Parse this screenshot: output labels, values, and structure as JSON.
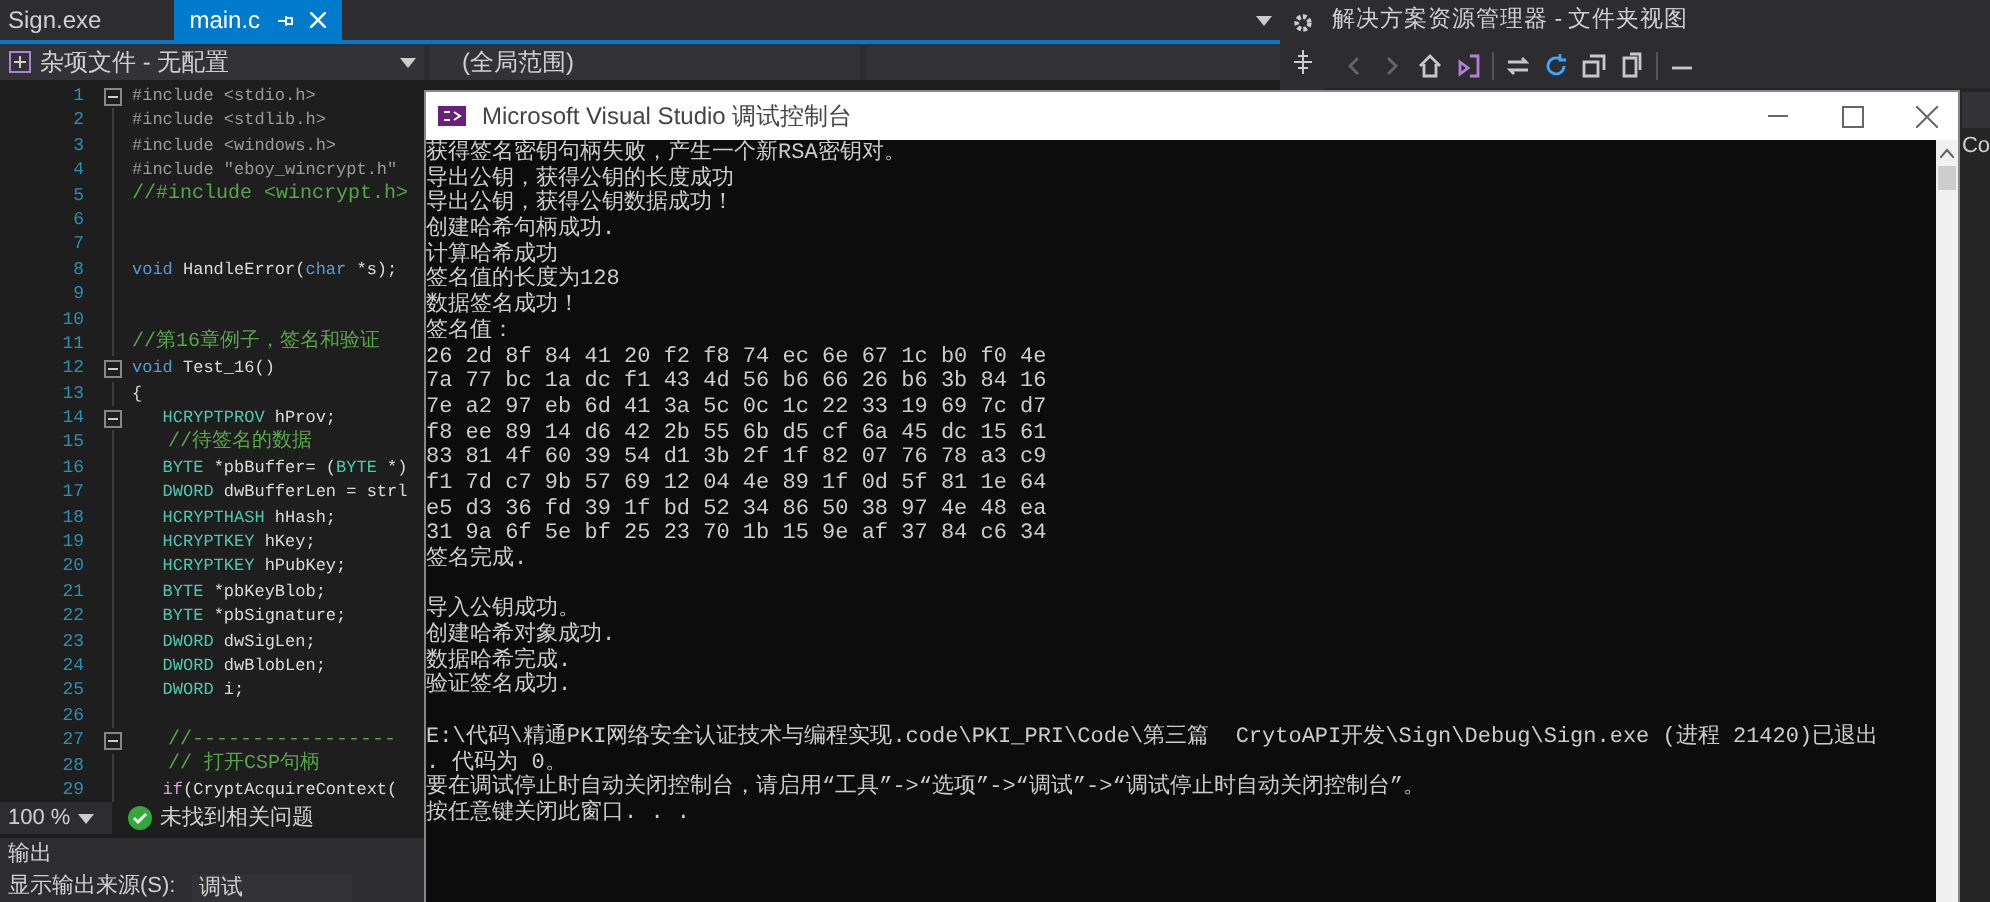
{
  "tabs": [
    {
      "label": "Sign.exe",
      "selected": false
    },
    {
      "label": "main.c",
      "selected": true
    }
  ],
  "nav": {
    "project": "杂项文件 - 无配置",
    "scope": "(全局范围)"
  },
  "code_lines": [
    {
      "number": "1",
      "fold": true,
      "tokens": [
        {
          "text": "#include <stdio.h>",
          "kind": "pp"
        }
      ]
    },
    {
      "number": "2",
      "fold": false,
      "tokens": [
        {
          "text": "#include <stdlib.h>",
          "kind": "pp"
        }
      ]
    },
    {
      "number": "3",
      "fold": false,
      "tokens": [
        {
          "text": "#include <windows.h>",
          "kind": "pp"
        }
      ]
    },
    {
      "number": "4",
      "fold": false,
      "tokens": [
        {
          "text": "#include \"eboy_wincrypt.h\"",
          "kind": "pp"
        }
      ]
    },
    {
      "number": "5",
      "fold": false,
      "tokens": [
        {
          "text": "//#include <wincrypt.h>",
          "kind": "comment"
        }
      ]
    },
    {
      "number": "6",
      "fold": false
    },
    {
      "number": "7",
      "fold": false
    },
    {
      "number": "8",
      "fold": false,
      "tokens": [
        {
          "text": "void",
          "kind": "kw"
        },
        {
          "text": " HandleError(",
          "kind": "id"
        },
        {
          "text": "char",
          "kind": "kw"
        },
        {
          "text": " *s);",
          "kind": "id"
        }
      ]
    },
    {
      "number": "9",
      "fold": false
    },
    {
      "number": "10",
      "fold": false
    },
    {
      "number": "11",
      "fold": false,
      "tokens": [
        {
          "text": "//第16章例子，签名和验证",
          "kind": "comment"
        }
      ]
    },
    {
      "number": "12",
      "fold": true,
      "tokens": [
        {
          "text": "void",
          "kind": "kw"
        },
        {
          "text": " Test_16()",
          "kind": "id"
        }
      ]
    },
    {
      "number": "13",
      "fold": false,
      "tokens": [
        {
          "text": "{",
          "kind": "id"
        }
      ]
    },
    {
      "number": "14",
      "fold": true,
      "tokens": [
        {
          "text": "   HCRYPTPROV",
          "kind": "type"
        },
        {
          "text": " hProv;",
          "kind": "id"
        }
      ]
    },
    {
      "number": "15",
      "fold": false,
      "tokens": [
        {
          "text": "   //待签名的数据",
          "kind": "comment"
        }
      ]
    },
    {
      "number": "16",
      "fold": false,
      "tokens": [
        {
          "text": "   BYTE",
          "kind": "type"
        },
        {
          "text": " *pbBuffer= (",
          "kind": "id"
        },
        {
          "text": "BYTE",
          "kind": "type"
        },
        {
          "text": " *)",
          "kind": "id"
        }
      ]
    },
    {
      "number": "17",
      "fold": false,
      "tokens": [
        {
          "text": "   DWORD",
          "kind": "type"
        },
        {
          "text": " dwBufferLen = strl",
          "kind": "id"
        }
      ]
    },
    {
      "number": "18",
      "fold": false,
      "tokens": [
        {
          "text": "   HCRYPTHASH",
          "kind": "type"
        },
        {
          "text": " hHash;",
          "kind": "id"
        }
      ]
    },
    {
      "number": "19",
      "fold": false,
      "tokens": [
        {
          "text": "   HCRYPTKEY",
          "kind": "type"
        },
        {
          "text": " hKey;",
          "kind": "id"
        }
      ]
    },
    {
      "number": "20",
      "fold": false,
      "tokens": [
        {
          "text": "   HCRYPTKEY",
          "kind": "type"
        },
        {
          "text": " hPubKey;",
          "kind": "id"
        }
      ]
    },
    {
      "number": "21",
      "fold": false,
      "tokens": [
        {
          "text": "   BYTE",
          "kind": "type"
        },
        {
          "text": " *pbKeyBlob;",
          "kind": "id"
        }
      ]
    },
    {
      "number": "22",
      "fold": false,
      "tokens": [
        {
          "text": "   BYTE",
          "kind": "type"
        },
        {
          "text": " *pbSignature;",
          "kind": "id"
        }
      ]
    },
    {
      "number": "23",
      "fold": false,
      "tokens": [
        {
          "text": "   DWORD",
          "kind": "type"
        },
        {
          "text": " dwSigLen;",
          "kind": "id"
        }
      ]
    },
    {
      "number": "24",
      "fold": false,
      "tokens": [
        {
          "text": "   DWORD",
          "kind": "type"
        },
        {
          "text": " dwBlobLen;",
          "kind": "id"
        }
      ]
    },
    {
      "number": "25",
      "fold": false,
      "tokens": [
        {
          "text": "   DWORD",
          "kind": "type"
        },
        {
          "text": " i;",
          "kind": "id"
        }
      ]
    },
    {
      "number": "26",
      "fold": false
    },
    {
      "number": "27",
      "fold": true,
      "tokens": [
        {
          "text": "   //-----------------",
          "kind": "comment"
        }
      ]
    },
    {
      "number": "28",
      "fold": false,
      "tokens": [
        {
          "text": "   // 打开CSP句柄",
          "kind": "comment"
        }
      ]
    },
    {
      "number": "29",
      "fold": false,
      "tokens": [
        {
          "text": "   if",
          "kind": "ctrl"
        },
        {
          "text": "(CryptAcquireContext(",
          "kind": "id"
        }
      ]
    }
  ],
  "editor_status": {
    "zoom": "100 %",
    "issues": "未找到相关问题"
  },
  "output_panel": {
    "title": "输出",
    "source_label": "显示输出来源(S):",
    "source": "调试"
  },
  "solution_explorer": {
    "title": "解决方案资源管理器 - 文件夹视图",
    "cut_text": "Co"
  },
  "console": {
    "title": "Microsoft Visual Studio 调试控制台",
    "blocks": [
      [
        "获得签名密钥句柄失败，产生一个新RSA密钥对。",
        "导出公钥，获得公钥的长度成功",
        "导出公钥，获得公钥数据成功！",
        "创建哈希句柄成功.",
        "计算哈希成功",
        "签名值的长度为128",
        "数据签名成功！",
        "签名值：",
        "26 2d 8f 84 41 20 f2 f8 74 ec 6e 67 1c b0 f0 4e",
        "7a 77 bc 1a dc f1 43 4d 56 b6 66 26 b6 3b 84 16",
        "7e a2 97 eb 6d 41 3a 5c 0c 1c 22 33 19 69 7c d7",
        "f8 ee 89 14 d6 42 2b 55 6b d5 cf 6a 45 dc 15 61",
        "83 81 4f 60 39 54 d1 3b 2f 1f 82 07 76 78 a3 c9",
        "f1 7d c7 9b 57 69 12 04 4e 89 1f 0d 5f 81 1e 64",
        "e5 d3 36 fd 39 1f bd 52 34 86 50 38 97 4e 48 ea",
        "31 9a 6f 5e bf 25 23 70 1b 15 9e af 37 84 c6 34",
        "签名完成."
      ],
      [
        "导入公钥成功。",
        "创建哈希对象成功.",
        "数据哈希完成.",
        "验证签名成功."
      ],
      [
        "E:\\代码\\精通PKI网络安全认证技术与编程实现.code\\PKI_PRI\\Code\\第三篇  CrytoAPI开发\\Sign\\Debug\\Sign.exe (进程 21420)已退出",
        ". 代码为 0。",
        "要在调试停止时自动关闭控制台，请启用“工具”->“选项”->“调试”->“调试停止时自动关闭控制台”。",
        "按任意键关闭此窗口. . ."
      ]
    ]
  }
}
